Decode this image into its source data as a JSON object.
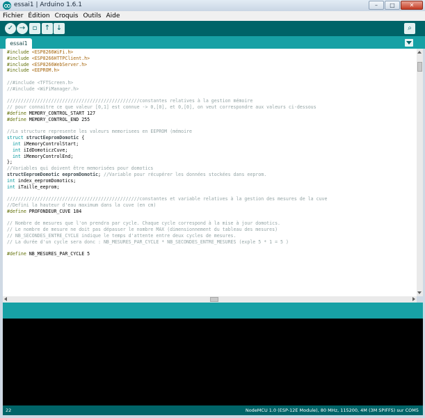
{
  "window": {
    "title": "essai1 | Arduino 1.6.1",
    "controls": {
      "minimize": "–",
      "maximize": "□",
      "close": "✕"
    }
  },
  "menu": [
    "Fichier",
    "Édition",
    "Croquis",
    "Outils",
    "Aide"
  ],
  "toolbar": {
    "verify_icon": "✓",
    "upload_icon": "→",
    "new_icon": "▫",
    "open_icon": "↑",
    "save_icon": "↓",
    "serial_monitor_icon": "⌕"
  },
  "tab": {
    "label": "essai1"
  },
  "code_lines": [
    [
      [
        "dir",
        "#include "
      ],
      [
        "str",
        "<ESP8266WiFi.h>"
      ]
    ],
    [
      [
        "dir",
        "#include "
      ],
      [
        "str",
        "<ESP8266HTTPClient.h>"
      ]
    ],
    [
      [
        "dir",
        "#include "
      ],
      [
        "str",
        "<ESP8266WebServer.h>"
      ]
    ],
    [
      [
        "dir",
        "#include "
      ],
      [
        "str",
        "<EEPROM.h>"
      ]
    ],
    [],
    [
      [
        "com",
        "//#include <TFTScreen.h>"
      ]
    ],
    [
      [
        "com",
        "//#include <WiFiManager.h>"
      ]
    ],
    [],
    [
      [
        "com",
        "////////////////////////////////////////////////constantes relatives à la gestion mémoire"
      ]
    ],
    [
      [
        "com",
        "// pour connaitre ce que valeur [0,1] est connue -> 0,[0], et 0,[0], on veut correspondre aux valeurs ci-dessous"
      ]
    ],
    [
      [
        "dir",
        "#define "
      ],
      [
        "txt",
        "MEMORY_CONTROL_START 127"
      ]
    ],
    [
      [
        "dir",
        "#define "
      ],
      [
        "txt",
        "MEMORY_CONTROL_END 255"
      ]
    ],
    [],
    [
      [
        "com",
        "//La structure represente les valeurs memorisees en EEPROM (mémoire"
      ]
    ],
    [
      [
        "kw",
        "struct "
      ],
      [
        "bold",
        "structEepromDomotic "
      ],
      [
        "txt",
        "{"
      ]
    ],
    [
      [
        "kw",
        "  int "
      ],
      [
        "txt",
        "iMemoryControlStart;"
      ]
    ],
    [
      [
        "kw",
        "  int "
      ],
      [
        "txt",
        "iIdDomoticzCuve;"
      ]
    ],
    [
      [
        "kw",
        "  int "
      ],
      [
        "txt",
        "iMemoryControlEnd;"
      ]
    ],
    [
      [
        "txt",
        "};"
      ]
    ],
    [
      [
        "com",
        "//Variables qui doivent être memorisées pour domotics"
      ]
    ],
    [
      [
        "bold",
        "structEepromDomotic eepromDomotic"
      ],
      [
        "txt",
        "; "
      ],
      [
        "com",
        "//Variable pour récupérer les données stockées dans eeprom."
      ]
    ],
    [
      [
        "kw",
        "int "
      ],
      [
        "txt",
        "index_eepromDomotics;"
      ]
    ],
    [
      [
        "kw",
        "int "
      ],
      [
        "txt",
        "iTaille_eeprom;"
      ]
    ],
    [],
    [
      [
        "com",
        "////////////////////////////////////////////////constantes et variable relatives à la gestion des mesures de la cuve"
      ]
    ],
    [
      [
        "com",
        "//Defini la hauteur d'eau maximum dans la cuve (en cm)"
      ]
    ],
    [
      [
        "dir",
        "#define "
      ],
      [
        "txt",
        "PROFONDEUR_CUVE 184"
      ]
    ],
    [],
    [
      [
        "com",
        "// Nombre de mesures que l'on prendra par cycle. Chaque cycle correspond à la mise à jour domotics."
      ]
    ],
    [
      [
        "com",
        "// Le nombre de mesure ne doit pas dépasser le nombre MAX (dimensionnement du tableau des mesures)"
      ]
    ],
    [
      [
        "com",
        "// NB_SECONDES_ENTRE_CYCLE indique le temps d'attente entre deux cycles de mesures."
      ]
    ],
    [
      [
        "com",
        "// La durée d'un cycle sera donc : NB_MESURES_PAR_CYCLE * NB_SECONDES_ENTRE_MESURES (exple 5 * 1 = 5 )"
      ]
    ],
    [],
    [
      [
        "dir",
        "#define "
      ],
      [
        "txt",
        "NB_MESURES_PAR_CYCLE 5"
      ]
    ]
  ],
  "footer": {
    "line_number": "22",
    "board_info": "NodeMCU 1.0 (ESP-12E Module), 80 MHz, 115200, 4M (3M SPIFFS) sur COM5"
  }
}
